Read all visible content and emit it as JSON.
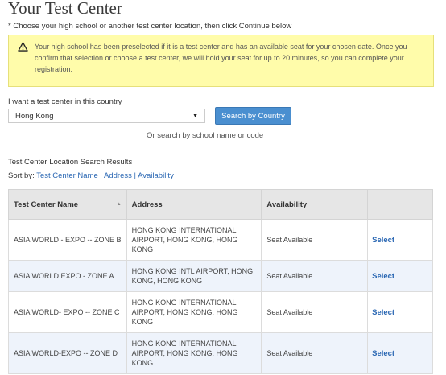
{
  "page_title": "Your Test Center",
  "instruction": "* Choose your high school or another test center location, then click Continue below",
  "alert": {
    "text": "Your high school has been preselected if it is a test center and has an available seat for your chosen date. Once you confirm that selection or choose a test center, we will hold your seat for up to 20 minutes, so you can complete your registration."
  },
  "country": {
    "label": "I want a test center in this country",
    "selected": "Hong Kong",
    "button": "Search by Country",
    "alt_search": "Or search by school name or code"
  },
  "results": {
    "title": "Test Center Location Search Results",
    "sort_prefix": "Sort by:",
    "sort_options": [
      "Test Center Name",
      "Address",
      "Availability"
    ],
    "columns": [
      "Test Center Name",
      "Address",
      "Availability",
      ""
    ],
    "rows": [
      {
        "name": "ASIA WORLD - EXPO -- ZONE B",
        "address": "HONG KONG INTERNATIONAL AIRPORT, HONG KONG, HONG KONG",
        "availability": "Seat Available",
        "action": "Select"
      },
      {
        "name": "ASIA WORLD EXPO - ZONE A",
        "address": "HONG KONG INTL AIRPORT, HONG KONG, HONG KONG",
        "availability": "Seat Available",
        "action": "Select"
      },
      {
        "name": "ASIA WORLD- EXPO -- ZONE C",
        "address": "HONG KONG INTERNATIONAL AIRPORT, HONG KONG, HONG KONG",
        "availability": "Seat Available",
        "action": "Select"
      },
      {
        "name": "ASIA WORLD-EXPO -- ZONE D",
        "address": "HONG KONG INTERNATIONAL AIRPORT, HONG KONG, HONG KONG",
        "availability": "Seat Available",
        "action": "Select"
      }
    ]
  },
  "colors": {
    "alert_bg": "#fffcaa",
    "button_bg": "#4a8fd0",
    "link": "#2a67b3",
    "row_alt": "#eef3fb"
  }
}
